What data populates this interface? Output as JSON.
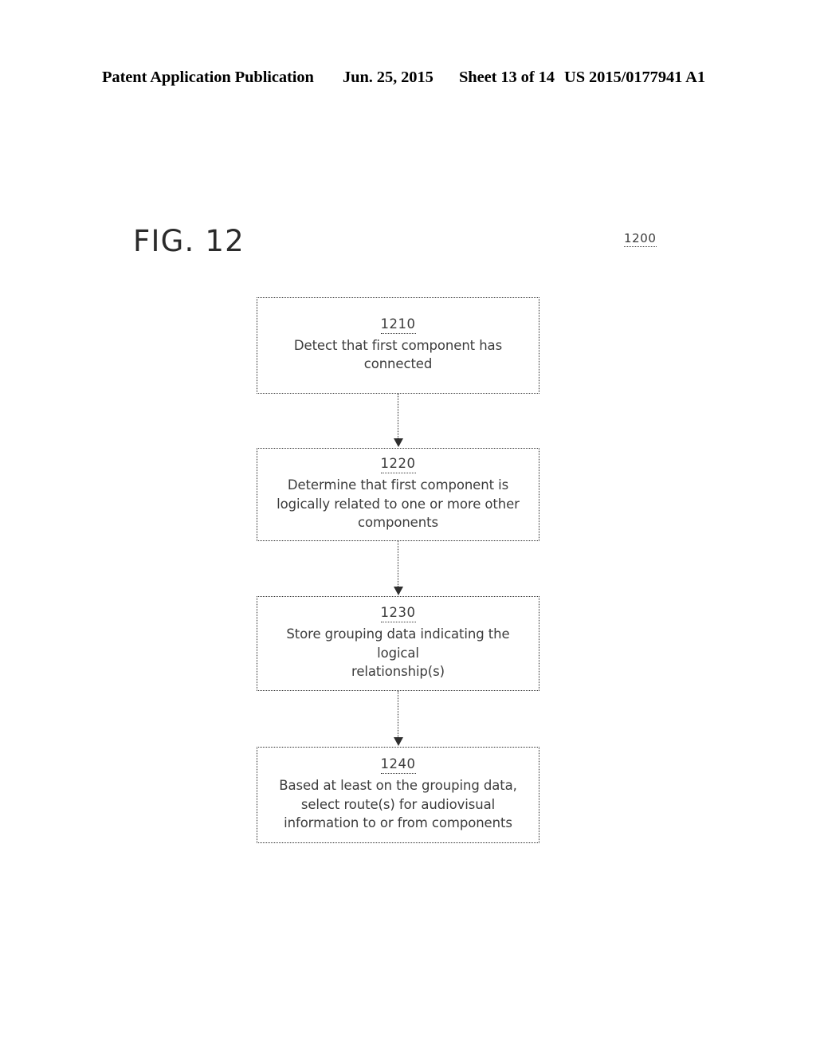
{
  "header": {
    "publication": "Patent Application Publication",
    "date": "Jun. 25, 2015",
    "sheet": "Sheet 13 of 14",
    "document_number": "US 2015/0177941 A1"
  },
  "figure": {
    "label": "FIG. 12",
    "reference_numeral": "1200"
  },
  "flowchart": {
    "nodes": [
      {
        "ref": "1210",
        "text": "Detect that first component has\nconnected"
      },
      {
        "ref": "1220",
        "text": "Determine that first component is\nlogically related to one or more other\ncomponents"
      },
      {
        "ref": "1230",
        "text": "Store grouping data indicating the logical\nrelationship(s)"
      },
      {
        "ref": "1240",
        "text": "Based at least on the grouping data,\nselect route(s) for audiovisual\ninformation to or from components"
      }
    ],
    "connectors": [
      {
        "name": "arrow-1210-to-1220",
        "direction": "down"
      },
      {
        "name": "arrow-1220-to-1230",
        "direction": "down"
      },
      {
        "name": "arrow-1230-to-1240",
        "direction": "down"
      }
    ]
  },
  "colors": {
    "ink": "#2e2e2e",
    "text": "#3c3c3c",
    "page_background": "#ffffff"
  }
}
